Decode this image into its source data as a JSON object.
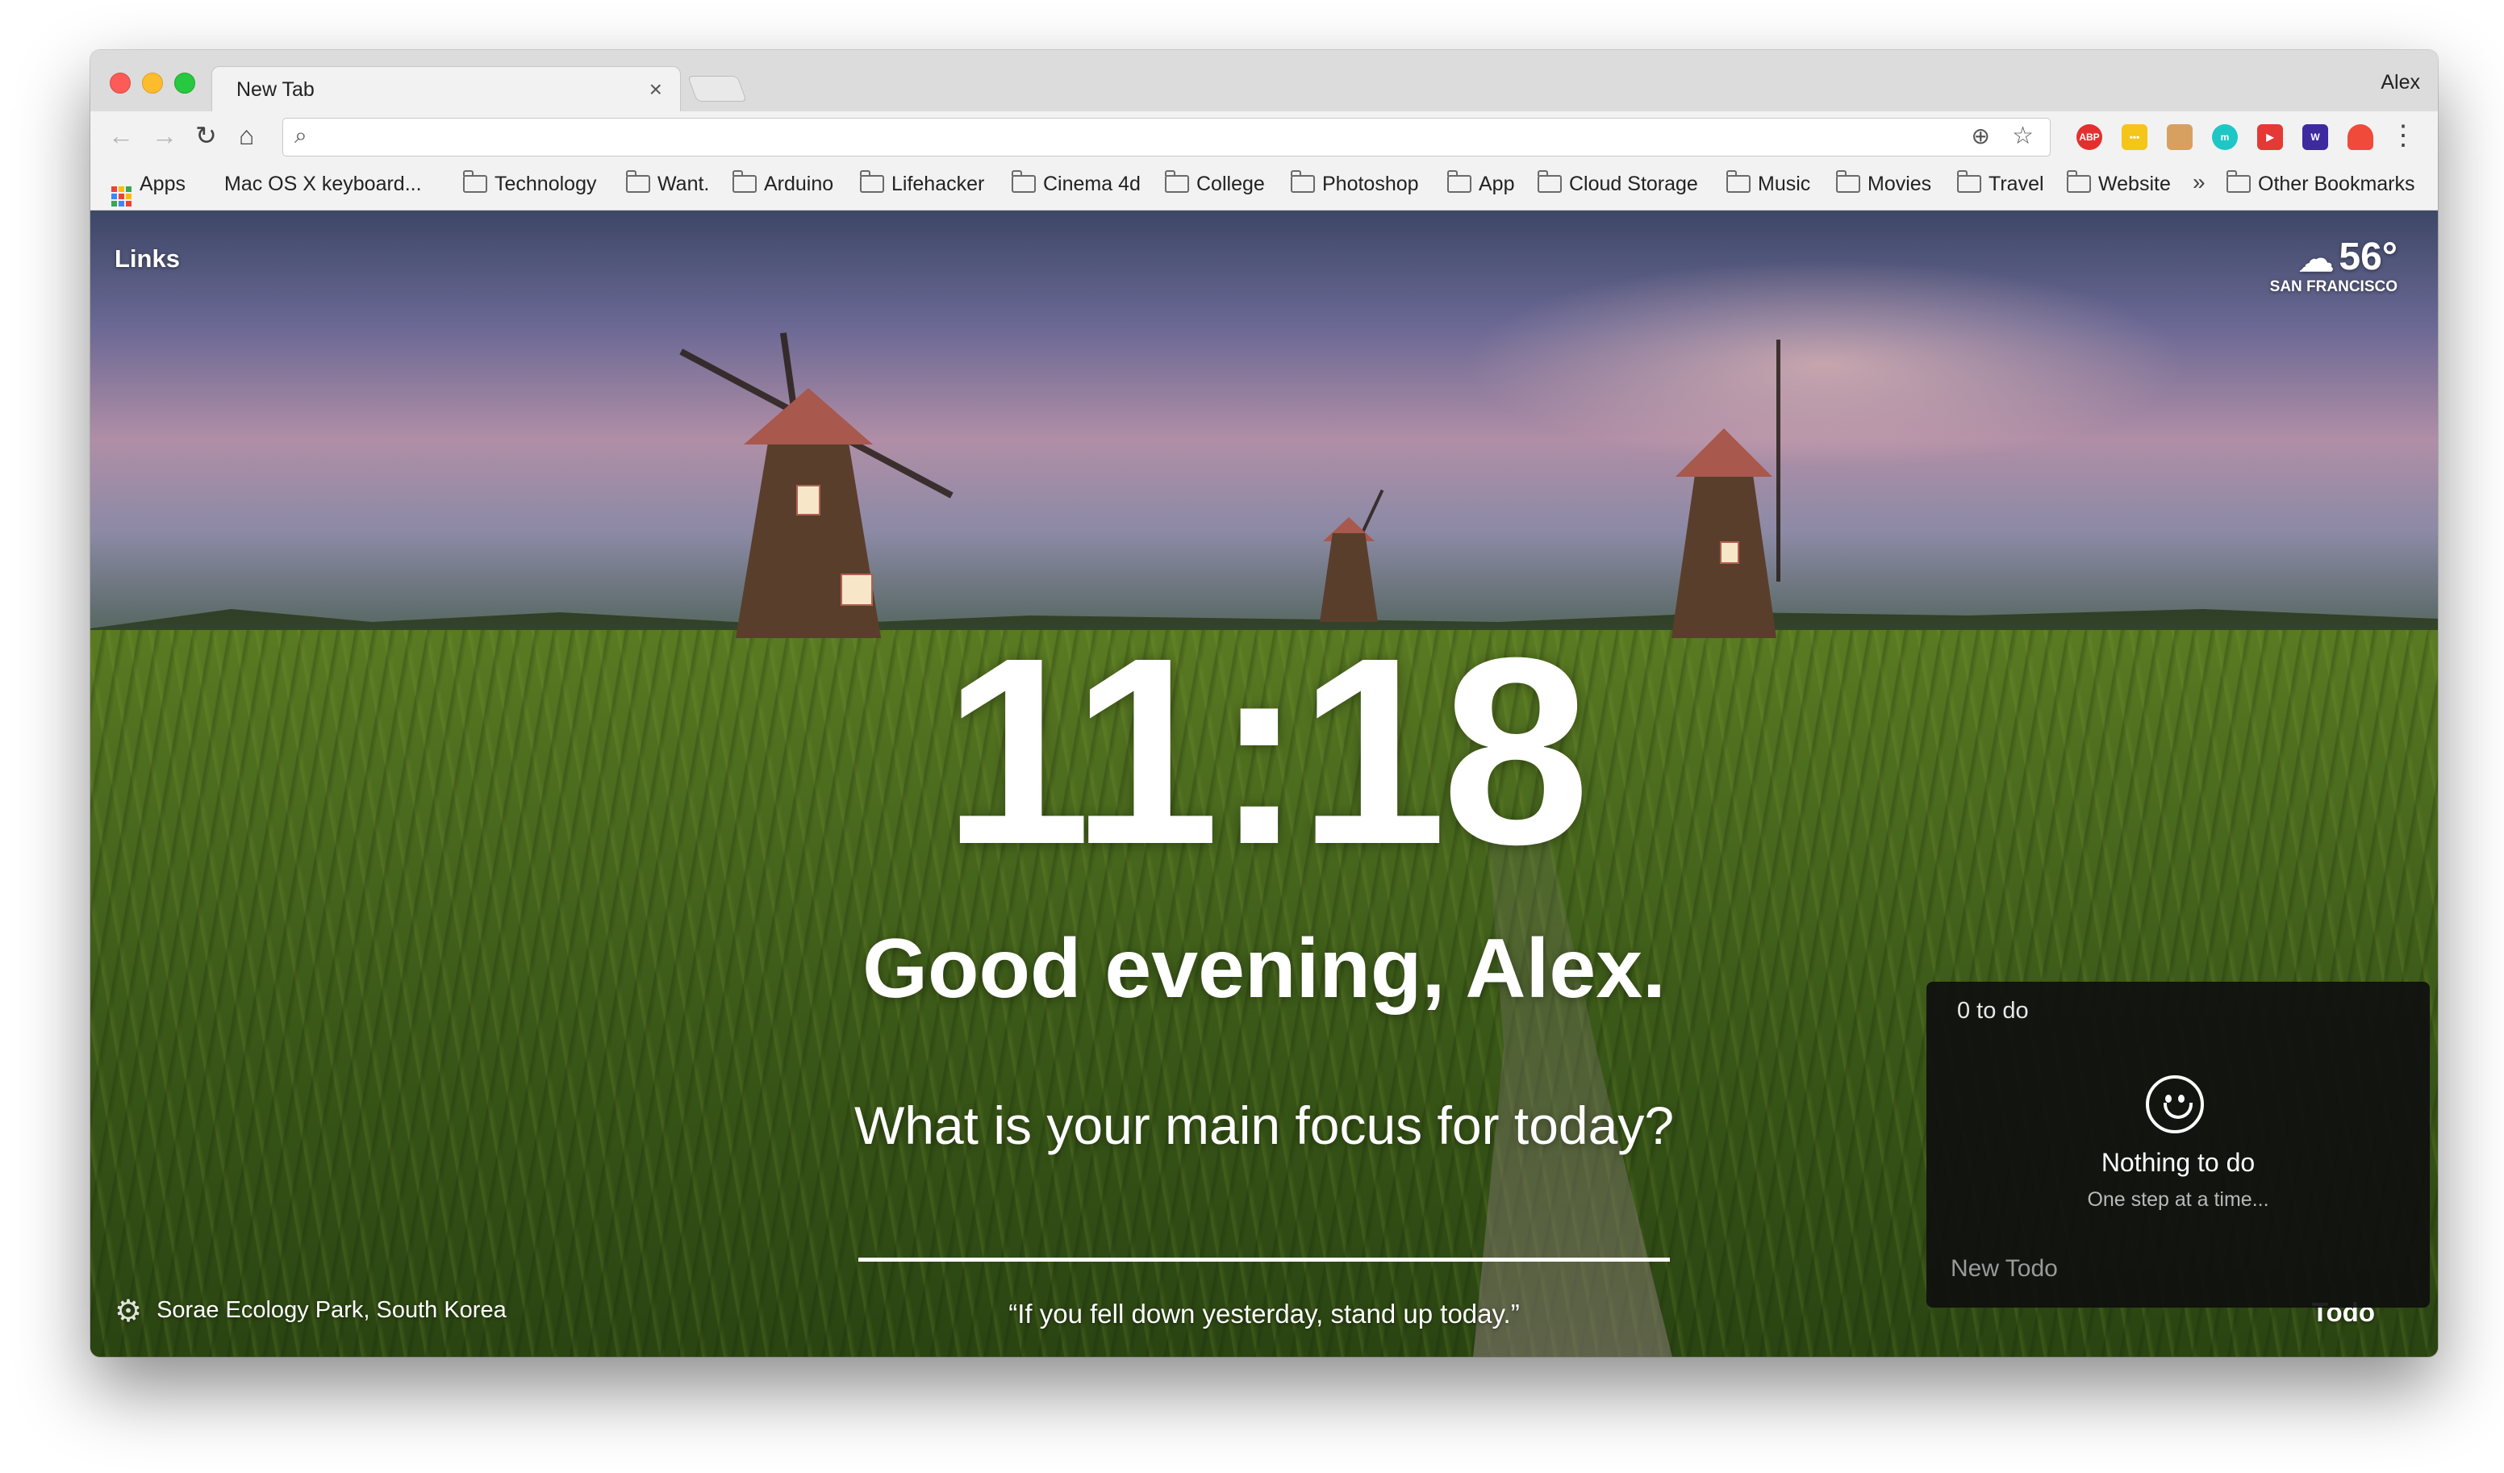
{
  "browser": {
    "tab_title": "New Tab",
    "tab_close": "×",
    "profile_name": "Alex",
    "address_value": "",
    "extensions": [
      {
        "name": "adblock-plus",
        "label": "ABP",
        "color": "#e52f2f"
      },
      {
        "name": "rss-extension",
        "label": "•••",
        "color": "#f5c518"
      },
      {
        "name": "character-extension",
        "label": "",
        "color": "#d8a060"
      },
      {
        "name": "teal-extension",
        "label": "m",
        "color": "#1fc6c6"
      },
      {
        "name": "youtube-extension",
        "label": "▶",
        "color": "#e53935"
      },
      {
        "name": "w-extension",
        "label": "W",
        "color": "#3d2a9e"
      },
      {
        "name": "ghost-extension",
        "label": "",
        "color": "#f04a3a"
      }
    ]
  },
  "bookmarks": {
    "items": [
      {
        "label": "Apps",
        "type": "apps"
      },
      {
        "label": "Mac OS X keyboard...",
        "type": "apple"
      },
      {
        "label": "Technology",
        "type": "folder"
      },
      {
        "label": "Want.",
        "type": "folder"
      },
      {
        "label": "Arduino",
        "type": "folder"
      },
      {
        "label": "Lifehacker",
        "type": "folder"
      },
      {
        "label": "Cinema 4d",
        "type": "folder"
      },
      {
        "label": "College",
        "type": "folder"
      },
      {
        "label": "Photoshop",
        "type": "folder"
      },
      {
        "label": "App",
        "type": "folder"
      },
      {
        "label": "Cloud Storage",
        "type": "folder"
      },
      {
        "label": "Music",
        "type": "folder"
      },
      {
        "label": "Movies",
        "type": "folder"
      },
      {
        "label": "Travel",
        "type": "folder"
      },
      {
        "label": "Website",
        "type": "folder"
      }
    ],
    "overflow": "»",
    "other": "Other Bookmarks"
  },
  "dashboard": {
    "links_label": "Links",
    "weather": {
      "temp": "56°",
      "city": "SAN FRANCISCO",
      "icon": "cloud-icon"
    },
    "clock": "11:18",
    "greeting": "Good evening, Alex.",
    "focus_question": "What is your main focus for today?",
    "focus_value": "",
    "location": "Sorae Ecology Park, South Korea",
    "quote": "“If you fell down yesterday, stand up today.”",
    "todo_label": "Todo"
  },
  "todo": {
    "count": "0 to do",
    "empty_title": "Nothing to do",
    "empty_subtitle": "One step at a time...",
    "new_placeholder": "New Todo"
  }
}
